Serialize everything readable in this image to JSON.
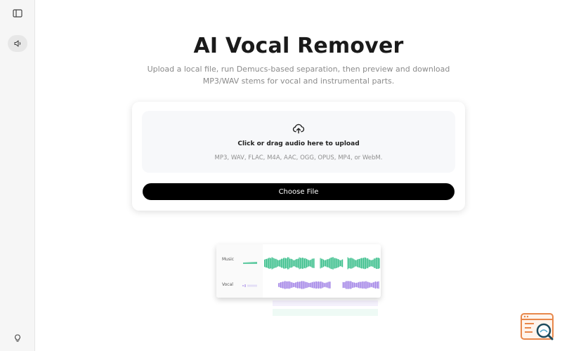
{
  "sidebar": {
    "items": [
      {
        "icon": "sidebar-toggle-icon"
      },
      {
        "icon": "speaker-icon",
        "active": true
      },
      {
        "icon": "lightbulb-icon"
      }
    ]
  },
  "hero": {
    "title": "AI Vocal Remover",
    "subtitle": "Upload a local file, run Demucs-based separation, then preview and download MP3/WAV stems for vocal and instrumental parts."
  },
  "upload": {
    "icon": "cloud-upload-icon",
    "title": "Click or drag audio here to upload",
    "formats": "MP3, WAV, FLAC, M4A, AAC, OGG, OPUS, MP4, or WebM.",
    "button_label": "Choose File"
  },
  "preview": {
    "tracks": [
      {
        "label": "Music",
        "color": "#3fc08e"
      },
      {
        "label": "Vocal",
        "color": "#a78be8"
      }
    ]
  },
  "colors": {
    "accent": "#000000",
    "music": "#3fc08e",
    "vocal": "#a78be8",
    "fab": "#e8874a"
  }
}
